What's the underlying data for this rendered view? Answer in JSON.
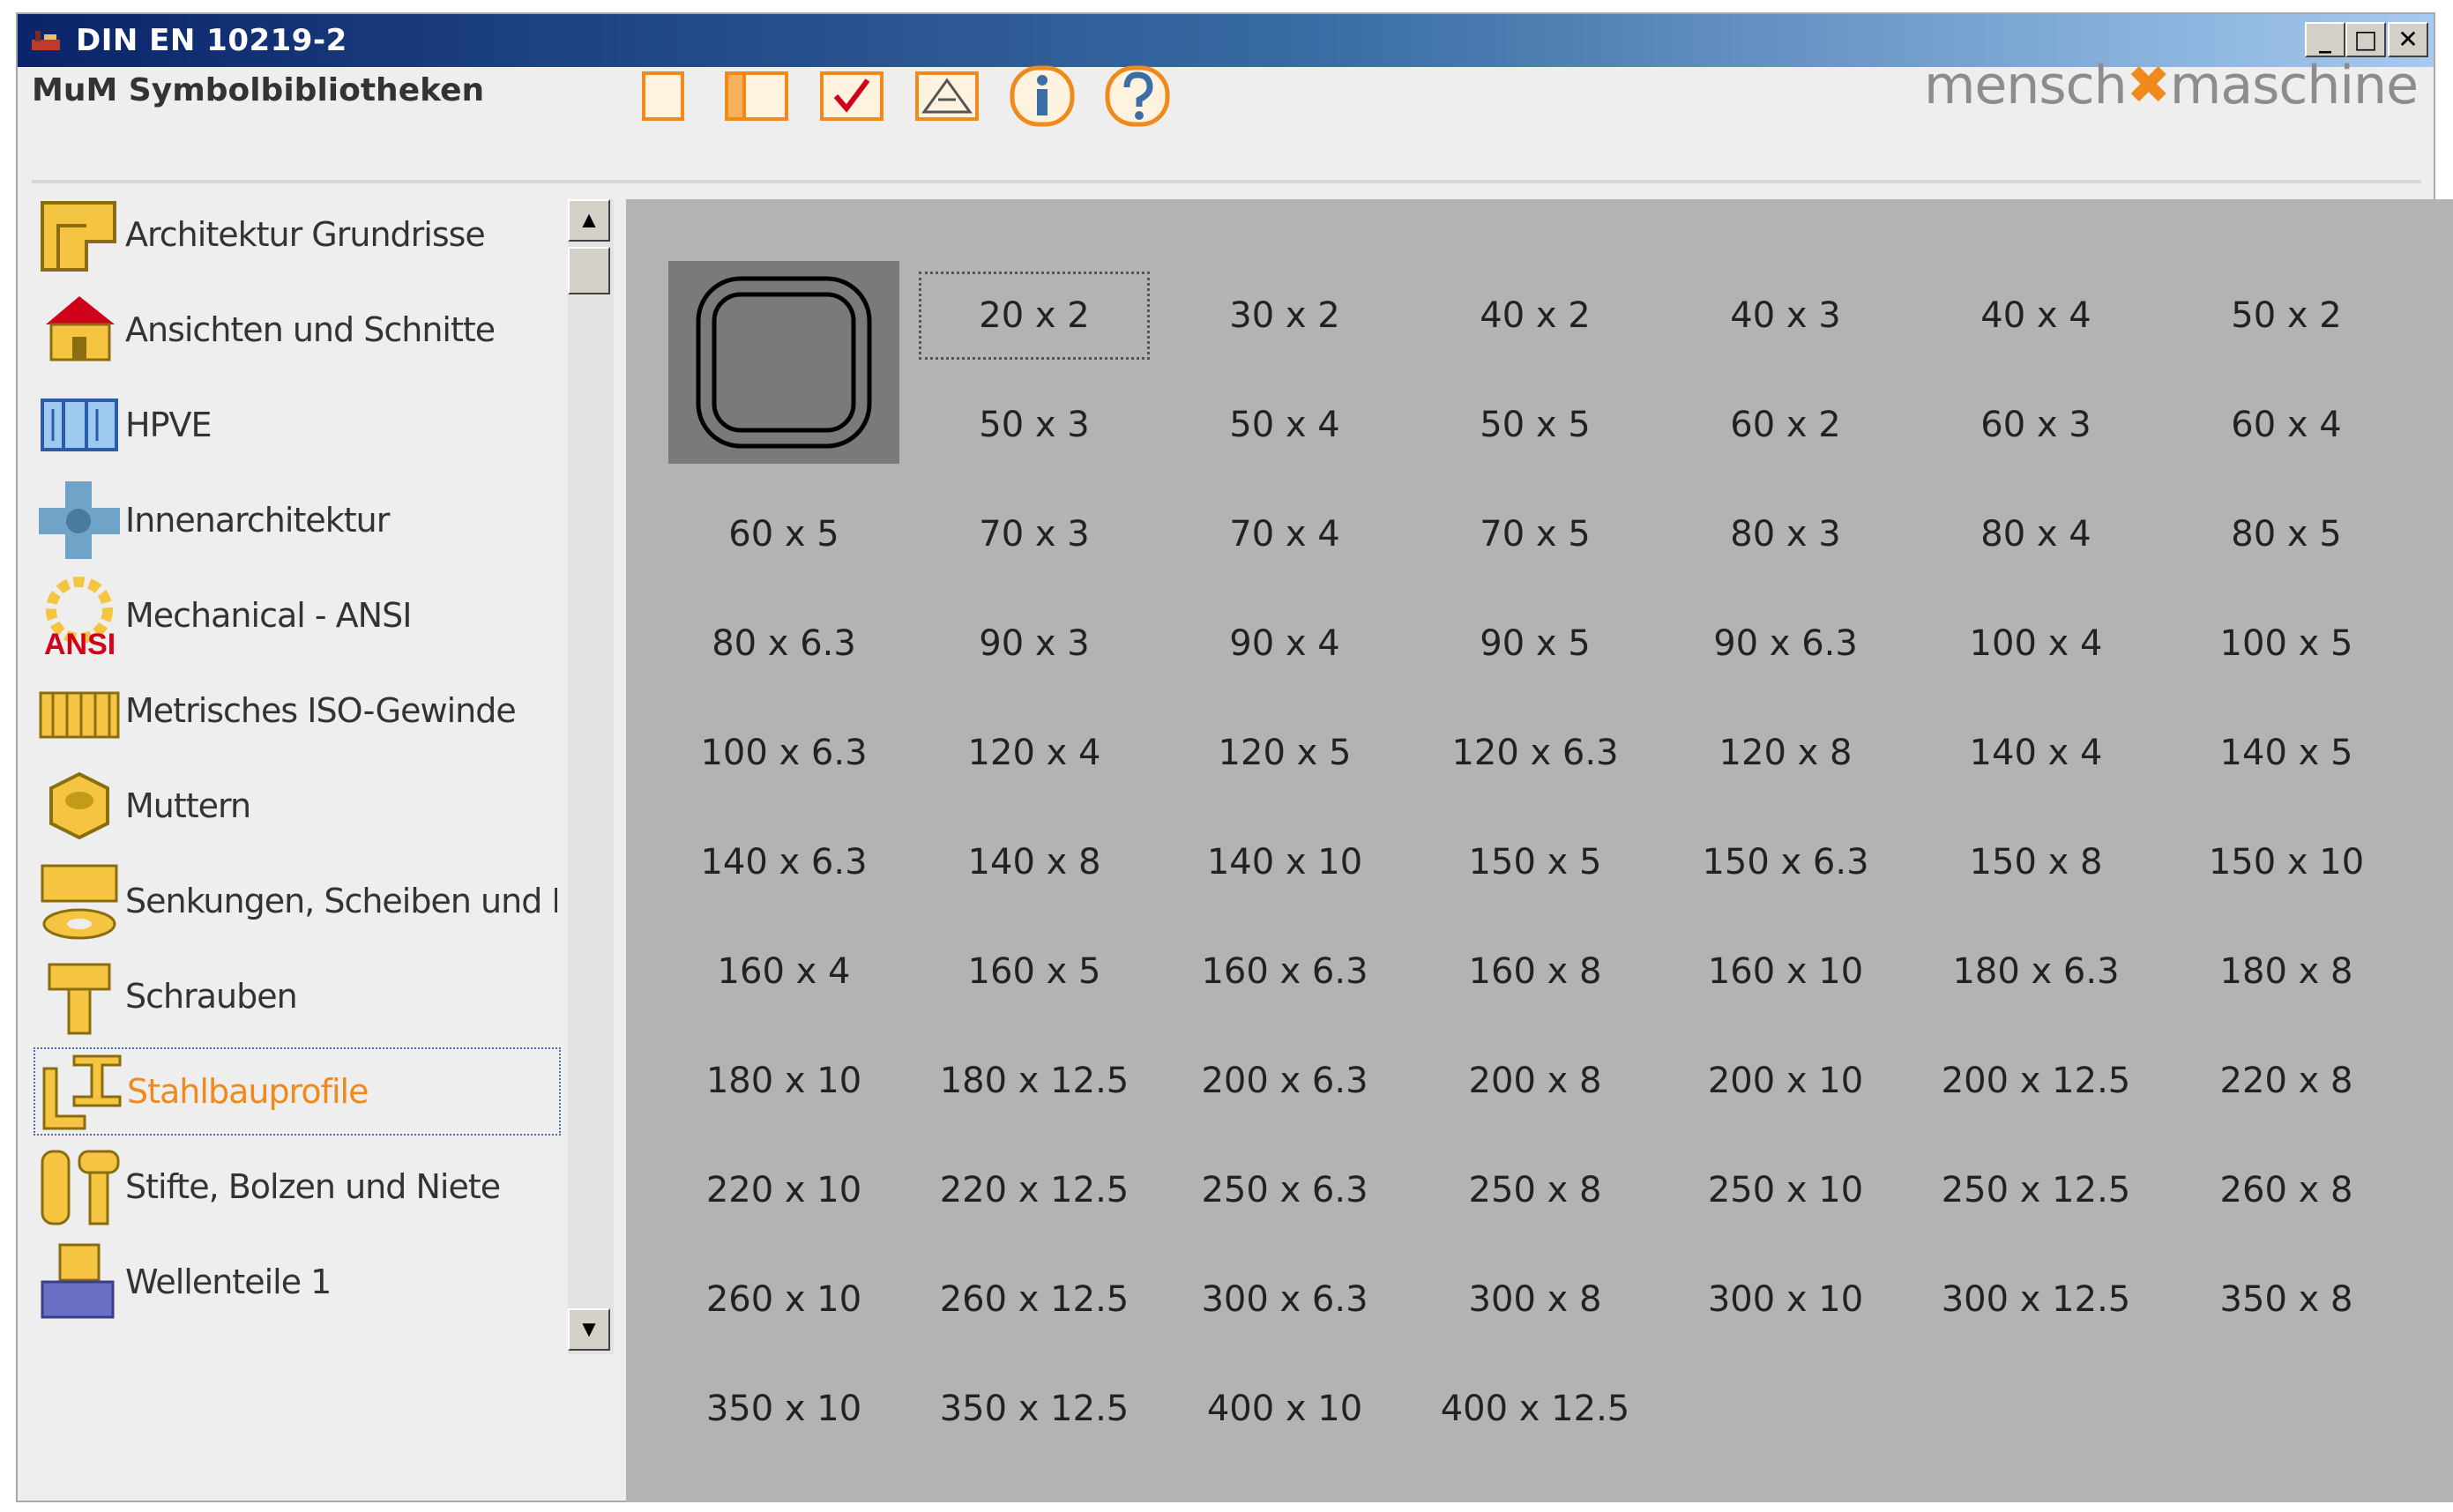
{
  "window": {
    "title": "DIN EN 10219-2",
    "controls": {
      "minimize": "_",
      "maximize": "□",
      "close": "✕"
    }
  },
  "toolbar": {
    "library_title": "MuM Symbolbibliotheken",
    "brand_left": "mensch",
    "brand_mark": "✖",
    "brand_right": "maschine",
    "buttons": [
      "blank-page-icon",
      "open-page-icon",
      "check-icon",
      "measure-icon",
      "info-icon",
      "help-icon"
    ]
  },
  "sidebar": {
    "items": [
      {
        "label": "Architektur Grundrisse",
        "icon": "floorplan-icon"
      },
      {
        "label": "Ansichten und Schnitte",
        "icon": "house-icon"
      },
      {
        "label": "HPVE",
        "icon": "hpve-icon"
      },
      {
        "label": "Innenarchitektur",
        "icon": "interior-icon"
      },
      {
        "label": "Mechanical - ANSI",
        "icon": "ansi-gear-icon",
        "badge": "ANSI"
      },
      {
        "label": "Metrisches ISO-Gewinde",
        "icon": "thread-icon"
      },
      {
        "label": "Muttern",
        "icon": "nut-icon"
      },
      {
        "label": "Senkungen, Scheiben und Du",
        "icon": "washer-icon"
      },
      {
        "label": "Schrauben",
        "icon": "screw-icon"
      },
      {
        "label": "Stahlbauprofile",
        "icon": "steel-profile-icon",
        "selected": true
      },
      {
        "label": "Stifte, Bolzen und Niete",
        "icon": "pin-icon"
      },
      {
        "label": "Wellenteile 1",
        "icon": "shaft-icon"
      }
    ],
    "scroll_up": "▲",
    "scroll_down": "▼"
  },
  "grid": {
    "focused_index": 0,
    "items": [
      "20 x 2",
      "30 x 2",
      "40 x 2",
      "40 x 3",
      "40 x 4",
      "50 x 2",
      "50 x 3",
      "50 x 4",
      "50 x 5",
      "60 x 2",
      "60 x 3",
      "60 x 4",
      "60 x 5",
      "70 x 3",
      "70 x 4",
      "70 x 5",
      "80 x 3",
      "80 x 4",
      "80 x 5",
      "80 x 6.3",
      "90 x 3",
      "90 x 4",
      "90 x 5",
      "90 x 6.3",
      "100 x 4",
      "100 x 5",
      "100 x 6.3",
      "120 x 4",
      "120 x 5",
      "120 x 6.3",
      "120 x 8",
      "140 x 4",
      "140 x 5",
      "140 x 6.3",
      "140 x 8",
      "140 x 10",
      "150 x 5",
      "150 x 6.3",
      "150 x 8",
      "150 x 10",
      "160 x 4",
      "160 x 5",
      "160 x 6.3",
      "160 x 8",
      "160 x 10",
      "180 x 6.3",
      "180 x 8",
      "180 x 10",
      "180 x 12.5",
      "200 x 6.3",
      "200 x 8",
      "200 x 10",
      "200 x 12.5",
      "220 x 8",
      "220 x 10",
      "220 x 12.5",
      "250 x 6.3",
      "250 x 8",
      "250 x 10",
      "250 x 12.5",
      "260 x 8",
      "260 x 10",
      "260 x 12.5",
      "300 x 6.3",
      "300 x 8",
      "300 x 10",
      "300 x 12.5",
      "350 x 8",
      "350 x 10",
      "350 x 12.5",
      "400 x 10",
      "400 x 12.5"
    ]
  },
  "colors": {
    "accent": "#f08a1c",
    "panel": "#b3b3b3",
    "title_start": "#0a246a"
  }
}
